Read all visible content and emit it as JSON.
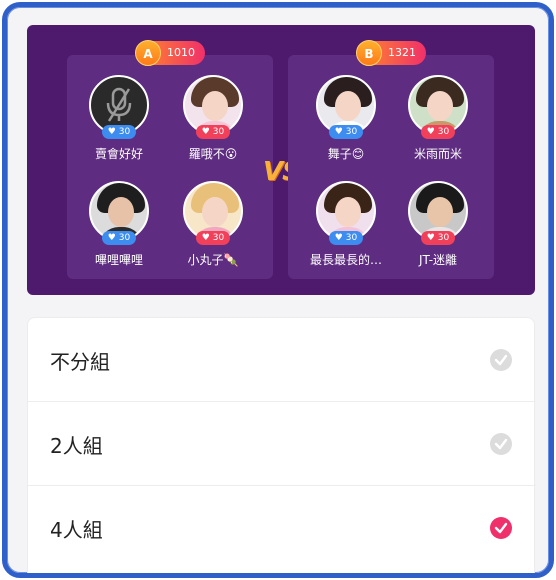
{
  "team_a": {
    "badge": "A",
    "score": "1010",
    "players": [
      {
        "name": "賣會好好",
        "hearts": "30",
        "heart_color": "blue",
        "muted": true
      },
      {
        "name": "羅哦不😮",
        "hearts": "30",
        "heart_color": "red"
      },
      {
        "name": "嗶哩嗶哩",
        "hearts": "30",
        "heart_color": "blue"
      },
      {
        "name": "小丸子🍡",
        "hearts": "30",
        "heart_color": "red"
      }
    ]
  },
  "team_b": {
    "badge": "B",
    "score": "1321",
    "players": [
      {
        "name": "舞子😊",
        "hearts": "30",
        "heart_color": "blue"
      },
      {
        "name": "米雨而米",
        "hearts": "30",
        "heart_color": "red"
      },
      {
        "name": "最長最長的…",
        "hearts": "30",
        "heart_color": "blue"
      },
      {
        "name": "JT-迷離",
        "hearts": "30",
        "heart_color": "red"
      }
    ]
  },
  "vs_label": "VS",
  "options": [
    {
      "label": "不分組",
      "selected": false
    },
    {
      "label": "2人組",
      "selected": false
    },
    {
      "label": "4人組",
      "selected": true
    }
  ],
  "colors": {
    "frame": "#2f5fc9",
    "battle_bg": "#4d1a6e",
    "accent": "#f0306a",
    "vs": "#f8b13a"
  }
}
